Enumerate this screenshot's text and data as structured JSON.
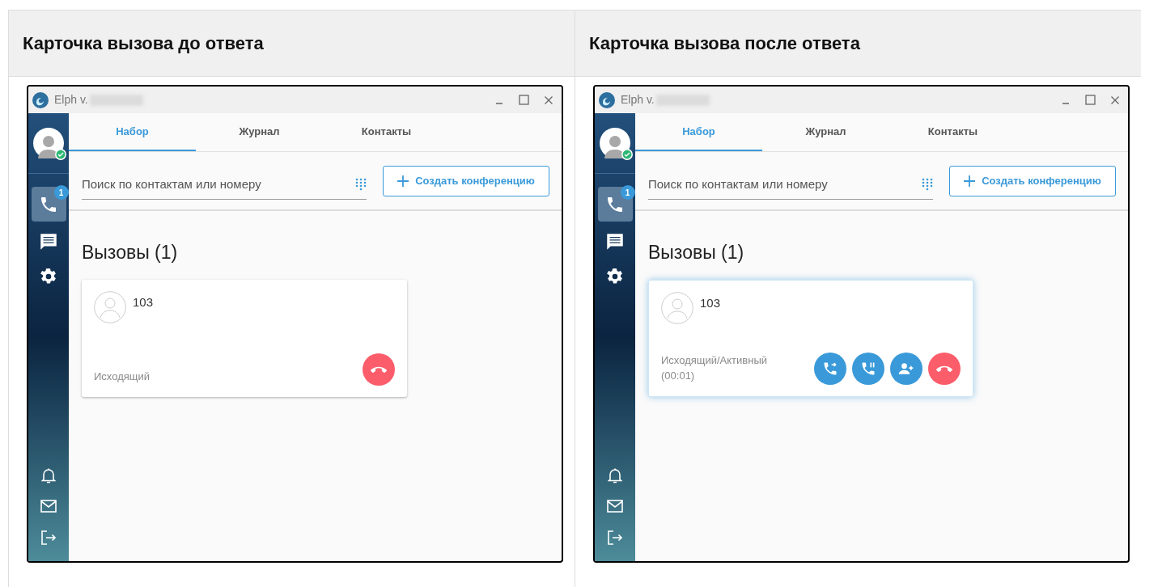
{
  "columns": [
    {
      "heading": "Карточка вызова до ответа",
      "app": {
        "title": "Elph v.",
        "tabs": [
          {
            "label": "Набор",
            "selected": true
          },
          {
            "label": "Журнал",
            "selected": false
          },
          {
            "label": "Контакты",
            "selected": false
          }
        ],
        "search": {
          "placeholder": "Поиск по контактам или номеру"
        },
        "conference_button": "Создать конференцию",
        "calls_badge": "1",
        "section_title": "Вызовы (1)",
        "call": {
          "number": "103",
          "active": false,
          "status_lines": [
            "Исходящий"
          ],
          "actions": [
            {
              "kind": "hangup"
            }
          ]
        }
      }
    },
    {
      "heading": "Карточка вызова после ответа",
      "app": {
        "title": "Elph v.",
        "tabs": [
          {
            "label": "Набор",
            "selected": true
          },
          {
            "label": "Журнал",
            "selected": false
          },
          {
            "label": "Контакты",
            "selected": false
          }
        ],
        "search": {
          "placeholder": "Поиск по контактам или номеру"
        },
        "conference_button": "Создать конференцию",
        "calls_badge": "1",
        "section_title": "Вызовы (1)",
        "call": {
          "number": "103",
          "active": true,
          "status_lines": [
            "Исходящий/Активный",
            "(00:01)"
          ],
          "actions": [
            {
              "kind": "transfer"
            },
            {
              "kind": "hold"
            },
            {
              "kind": "add-participant"
            },
            {
              "kind": "hangup"
            }
          ]
        }
      }
    }
  ]
}
